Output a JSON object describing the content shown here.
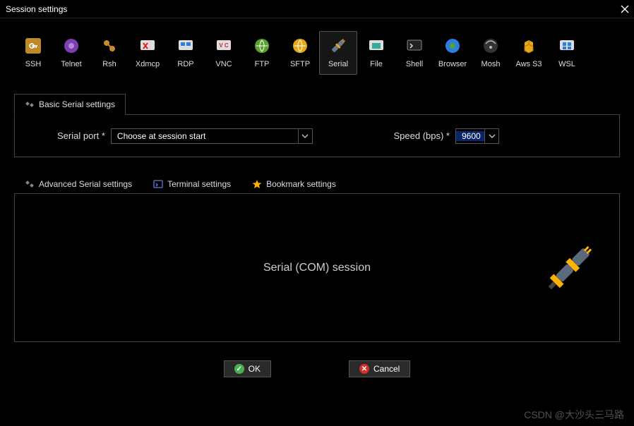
{
  "window": {
    "title": "Session settings"
  },
  "protocols": [
    {
      "label": "SSH",
      "icon": "key-icon"
    },
    {
      "label": "Telnet",
      "icon": "telnet-icon"
    },
    {
      "label": "Rsh",
      "icon": "rsh-icon"
    },
    {
      "label": "Xdmcp",
      "icon": "xdmcp-icon"
    },
    {
      "label": "RDP",
      "icon": "rdp-icon"
    },
    {
      "label": "VNC",
      "icon": "vnc-icon"
    },
    {
      "label": "FTP",
      "icon": "ftp-icon"
    },
    {
      "label": "SFTP",
      "icon": "sftp-icon"
    },
    {
      "label": "Serial",
      "icon": "serial-icon",
      "selected": true
    },
    {
      "label": "File",
      "icon": "file-icon"
    },
    {
      "label": "Shell",
      "icon": "shell-icon"
    },
    {
      "label": "Browser",
      "icon": "browser-icon"
    },
    {
      "label": "Mosh",
      "icon": "mosh-icon"
    },
    {
      "label": "Aws S3",
      "icon": "aws-icon"
    },
    {
      "label": "WSL",
      "icon": "wsl-icon"
    }
  ],
  "basic_tab": {
    "label": "Basic Serial settings"
  },
  "fields": {
    "port_label": "Serial port *",
    "port_value": "Choose at session start",
    "speed_label": "Speed (bps) *",
    "speed_value": "9600"
  },
  "adv_tabs": [
    {
      "label": "Advanced Serial settings",
      "icon": "serial-small-icon"
    },
    {
      "label": "Terminal settings",
      "icon": "terminal-small-icon"
    },
    {
      "label": "Bookmark settings",
      "icon": "star-icon"
    }
  ],
  "panel": {
    "caption": "Serial (COM) session"
  },
  "buttons": {
    "ok": "OK",
    "cancel": "Cancel"
  },
  "watermark": "CSDN @大沙头三马路"
}
